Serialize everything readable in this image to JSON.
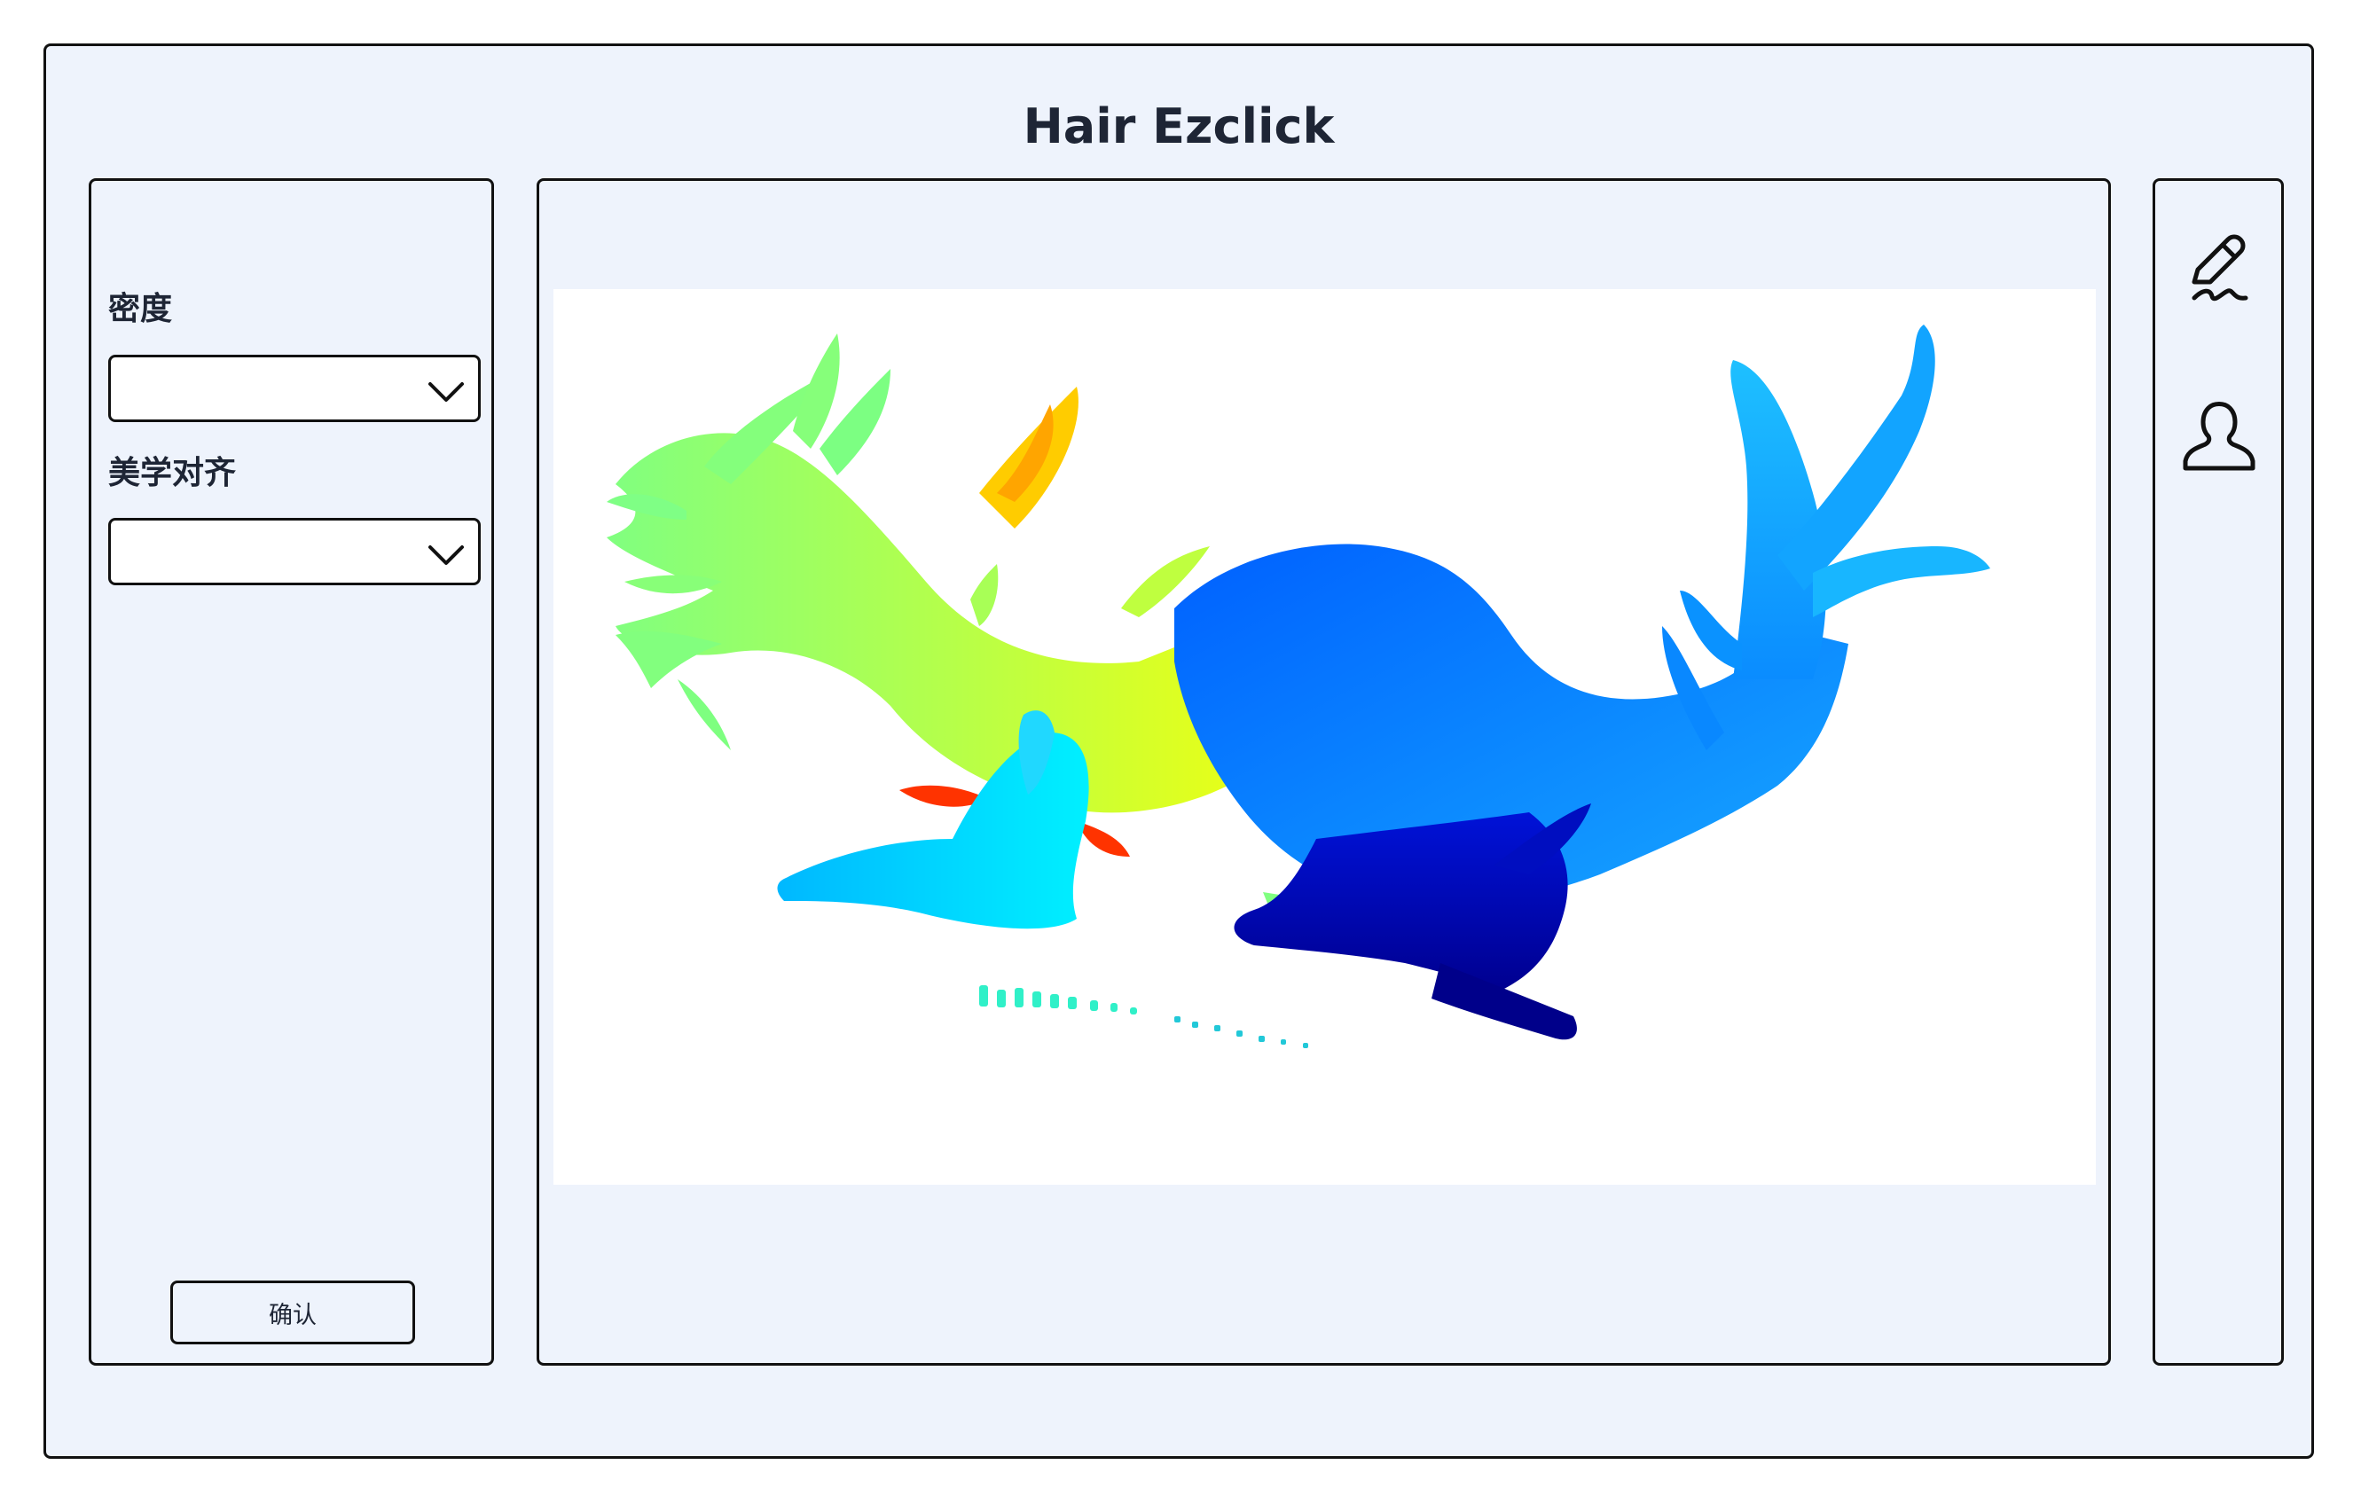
{
  "app": {
    "title": "Hair Ezclick"
  },
  "left_panel": {
    "density": {
      "label": "密度",
      "value": ""
    },
    "aesthetic_alignment": {
      "label": "美学对齐",
      "value": ""
    },
    "confirm_label": "确认"
  },
  "viewer": {
    "content": "3D hair strand rendering with depth colormap",
    "colormap": [
      "#000080",
      "#0000ff",
      "#0080ff",
      "#00e5ff",
      "#80ff80",
      "#e5ff1a",
      "#ffa500",
      "#ff3300"
    ]
  },
  "right_toolbar": {
    "tools": [
      {
        "icon": "pen-signature-icon"
      },
      {
        "icon": "user-profile-icon"
      }
    ]
  },
  "colors": {
    "window_bg": "#eef3fc",
    "border": "#111111",
    "viewer_bg": "#ffffff",
    "text": "#1e2535"
  }
}
